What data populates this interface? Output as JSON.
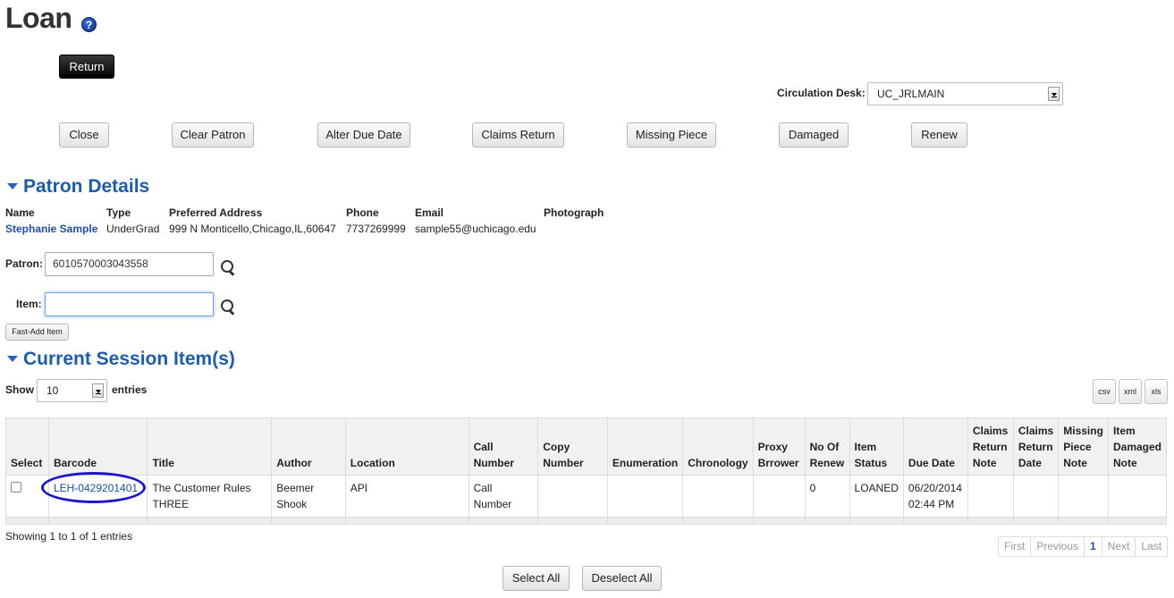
{
  "page": {
    "title": "Loan",
    "help_icon": "?"
  },
  "top_actions": {
    "return_label": "Return"
  },
  "circulation": {
    "label": "Circulation Desk:",
    "selected": "UC_JRLMAIN"
  },
  "action_buttons": [
    "Close",
    "Clear Patron",
    "Alter Due Date",
    "Claims Return",
    "Missing Piece",
    "Damaged",
    "Renew"
  ],
  "patron_details": {
    "heading": "Patron Details",
    "headers": {
      "name": "Name",
      "type": "Type",
      "address": "Preferred Address",
      "phone": "Phone",
      "email": "Email",
      "photo": "Photograph"
    },
    "values": {
      "name": "Stephanie Sample",
      "type": "UnderGrad",
      "address": "999 N Monticello,Chicago,IL,60647",
      "phone": "7737269999",
      "email": "sample55@uchicago.edu"
    }
  },
  "patron_field": {
    "label": "Patron:",
    "value": "6010570003043558"
  },
  "item_field": {
    "label": "Item:",
    "value": ""
  },
  "fast_add_label": "Fast-Add Item",
  "session": {
    "heading": "Current Session Item(s)",
    "show_label": "Show",
    "entries_value": "10",
    "entries_label": "entries",
    "export": [
      "csv",
      "xml",
      "xls"
    ],
    "columns": [
      "Select",
      "Barcode",
      "Title",
      "Author",
      "Location",
      "Call Number",
      "Copy Number",
      "Enumeration",
      "Chronology",
      "Proxy Brrower",
      "No Of Renew",
      "Item Status",
      "Due Date",
      "Claims Return Note",
      "Claims Return Date",
      "Missing Piece Note",
      "Item Damaged Note"
    ],
    "rows": [
      {
        "barcode": "LEH-0429201401",
        "title": "The Customer Rules THREE",
        "author": "Beemer Shook",
        "location": "API",
        "call_number": "Call Number",
        "copy_number": "",
        "enumeration": "",
        "chronology": "",
        "proxy": "",
        "renew": "0",
        "status": "LOANED",
        "due_date": "06/20/2014 02:44 PM",
        "cr_note": "",
        "cr_date": "",
        "mp_note": "",
        "dmg_note": ""
      }
    ],
    "info": "Showing 1 to 1 of 1 entries",
    "pager": {
      "first": "First",
      "previous": "Previous",
      "page": "1",
      "next": "Next",
      "last": "Last"
    },
    "select_all": "Select All",
    "deselect_all": "Deselect All"
  },
  "colors": {
    "link": "#1e4fa0",
    "heading": "#1e5ba8",
    "highlight_oval": "#1d16c9"
  }
}
